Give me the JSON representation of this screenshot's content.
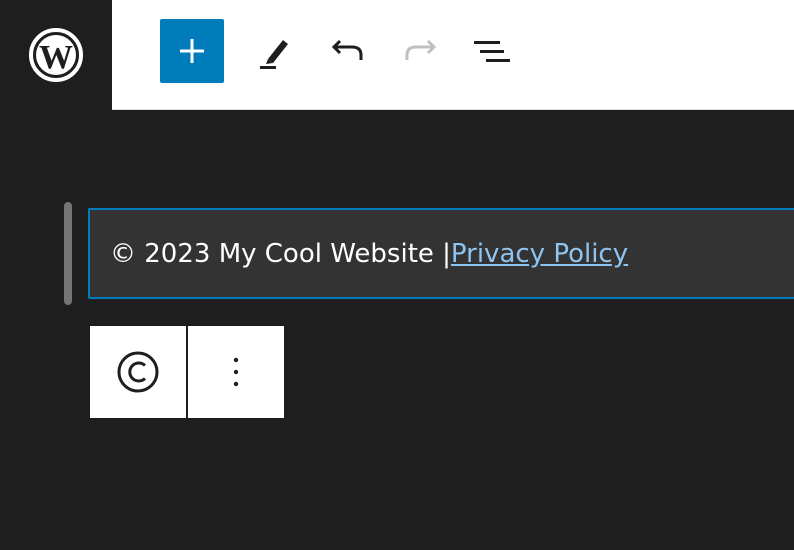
{
  "header": {
    "logo_icon": "wordpress-logo-icon",
    "toolbar": {
      "add_icon": "plus-icon",
      "edit_icon": "pencil-icon",
      "undo_icon": "undo-icon",
      "redo_icon": "redo-icon",
      "outline_icon": "list-view-icon",
      "accent_color": "#007cba"
    }
  },
  "canvas": {
    "footer": {
      "text": "© 2023 My Cool Website | ",
      "link_text": "Privacy Policy"
    },
    "block_toolbar": {
      "block_icon": "copyright-icon",
      "options_icon": "more-vertical-icon",
      "block_icon_glyph": "©",
      "options_glyph": "⋮"
    }
  }
}
